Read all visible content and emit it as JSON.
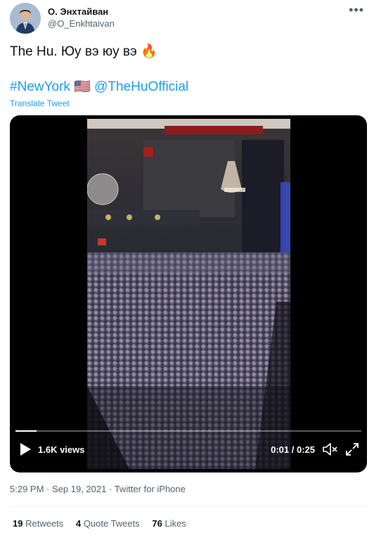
{
  "author": {
    "name": "О. Энхтайван",
    "handle": "@O_Enkhtaivan"
  },
  "menu_icon": "more-dots-icon",
  "tweet": {
    "text": "The Hu. Юу вэ юу вэ 🔥",
    "hashtag": "#NewYork",
    "flag": "🇺🇸",
    "mention": "@TheHuOfficial",
    "translate_label": "Translate Tweet"
  },
  "video": {
    "views": "1.6K views",
    "time": "0:01 / 0:25",
    "progress": 0.06,
    "icons": [
      "play-icon",
      "mute-icon",
      "expand-icon"
    ]
  },
  "meta": {
    "time": "5:29 PM",
    "date": "Sep 19, 2021",
    "source": "Twitter for iPhone"
  },
  "stats": {
    "retweets_count": "19",
    "retweets_label": "Retweets",
    "quotes_count": "4",
    "quotes_label": "Quote Tweets",
    "likes_count": "76",
    "likes_label": "Likes"
  },
  "colors": {
    "link": "#1d9bf0",
    "secondary_text": "#536471",
    "primary_text": "#0f1419"
  }
}
